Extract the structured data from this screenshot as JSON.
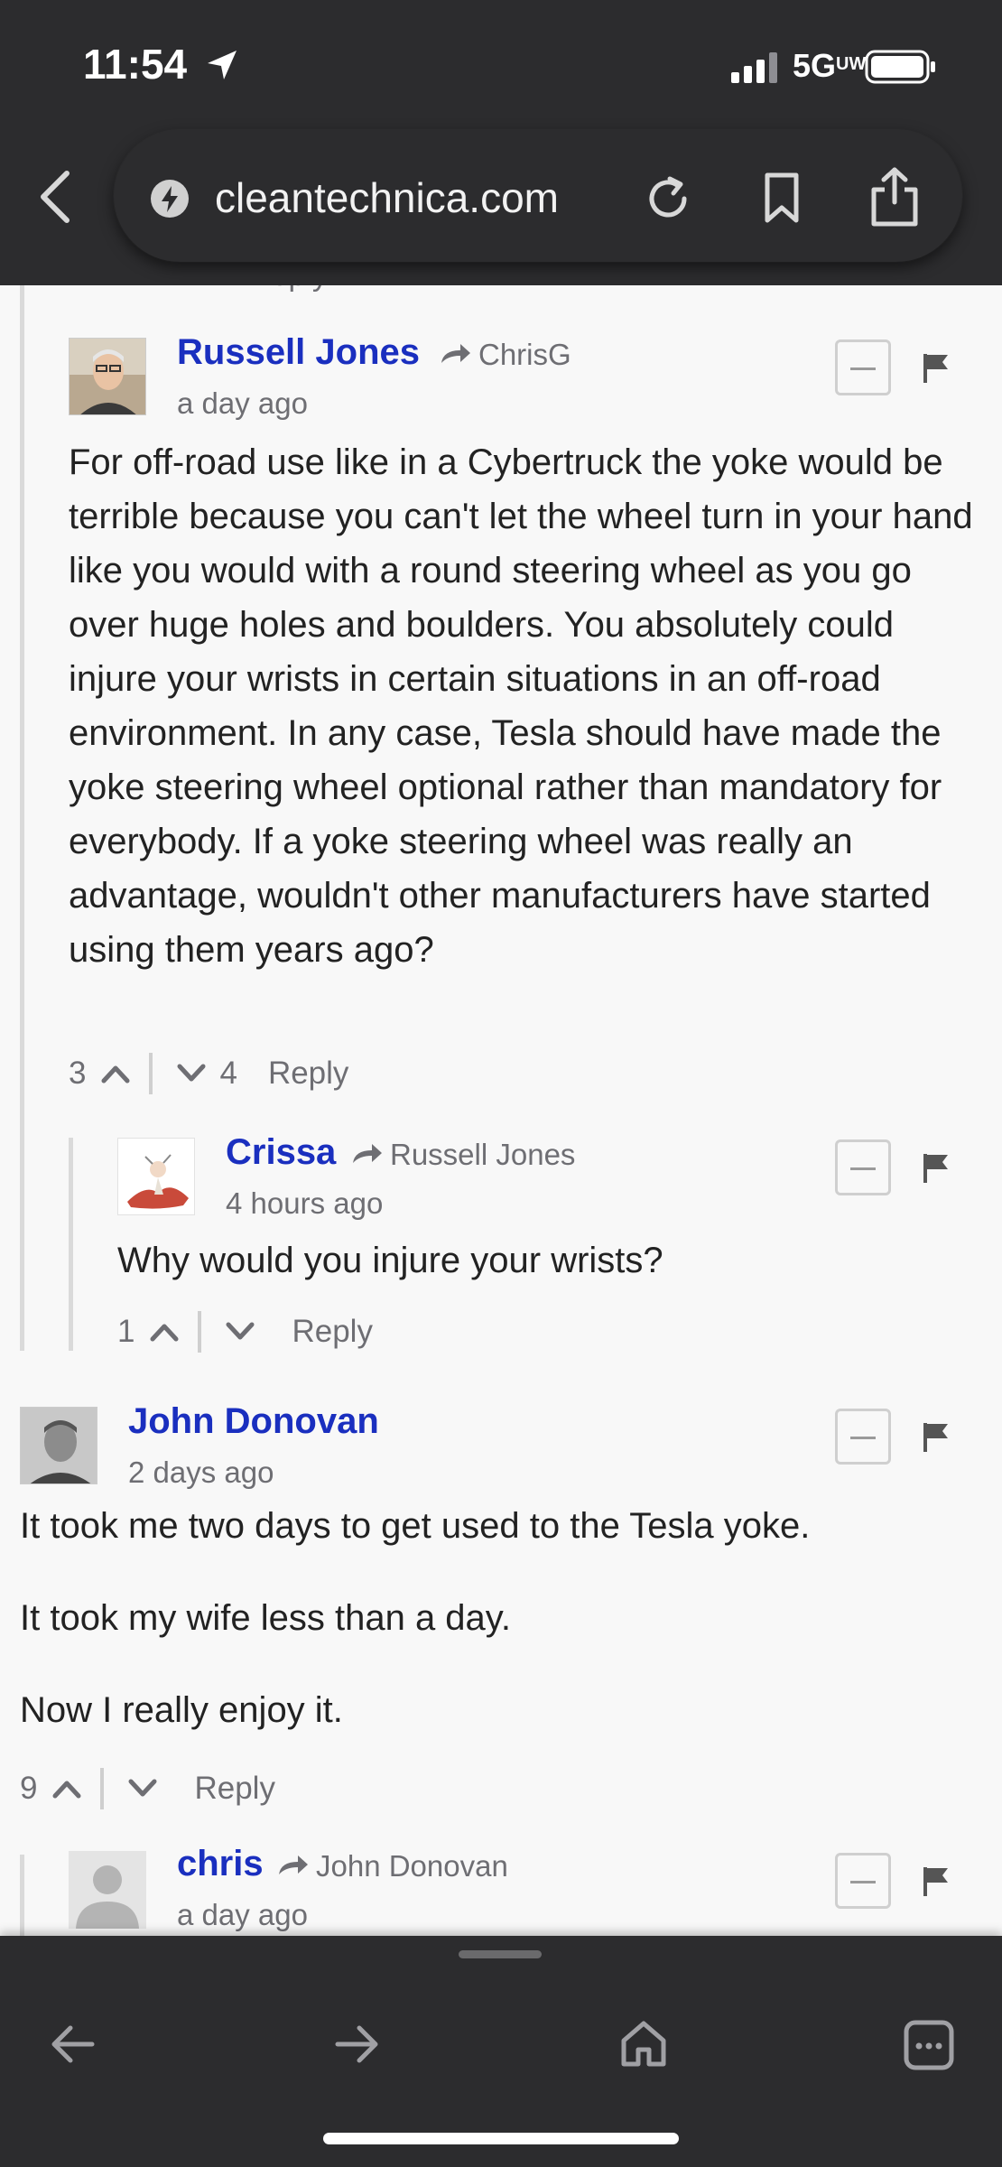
{
  "status_bar": {
    "time": "11:54",
    "network": "5GUW",
    "network_main": "5G",
    "network_sup": "UW"
  },
  "browser": {
    "url": "cleantechnica.com"
  },
  "previous_fragment": "Reply",
  "comments": [
    {
      "author": "Russell Jones",
      "reply_to": "ChrisG",
      "time": "a day ago",
      "text": "For off-road use like in a Cybertruck the yoke would be terrible because you can't let the wheel turn in your hand like you would with a round steering wheel as you go over huge holes and boulders. You absolutely could injure your wrists in certain situations in an off-road environment. In any case, Tesla should have made the yoke steering wheel optional rather than mandatory for everybody. If a yoke steering wheel was really an advantage, wouldn't other manufacturers have started using them years ago?",
      "upvotes": "3",
      "downvotes": "4",
      "reply_label": "Reply"
    },
    {
      "author": "Crissa",
      "reply_to": "Russell Jones",
      "time": "4 hours ago",
      "text": "Why would you injure your wrists?",
      "upvotes": "1",
      "downvotes": "",
      "reply_label": "Reply"
    },
    {
      "author": "John Donovan",
      "reply_to": "",
      "time": "2 days ago",
      "paragraphs": [
        "It took me two days to get used to the Tesla yoke.",
        "It took my wife less than a day.",
        "Now I really enjoy it."
      ],
      "upvotes": "9",
      "downvotes": "",
      "reply_label": "Reply"
    },
    {
      "author": "chris",
      "reply_to": "John Donovan",
      "time": "a day ago"
    }
  ],
  "toolbar": {
    "back": "back-arrow-icon",
    "forward": "forward-arrow-icon",
    "home": "home-icon",
    "menu": "more-menu-icon"
  },
  "colors": {
    "author_link": "#1a2fbf",
    "chrome_bg": "#2c2c2e",
    "page_bg": "#f8f8f8",
    "muted": "#6e6e73"
  }
}
